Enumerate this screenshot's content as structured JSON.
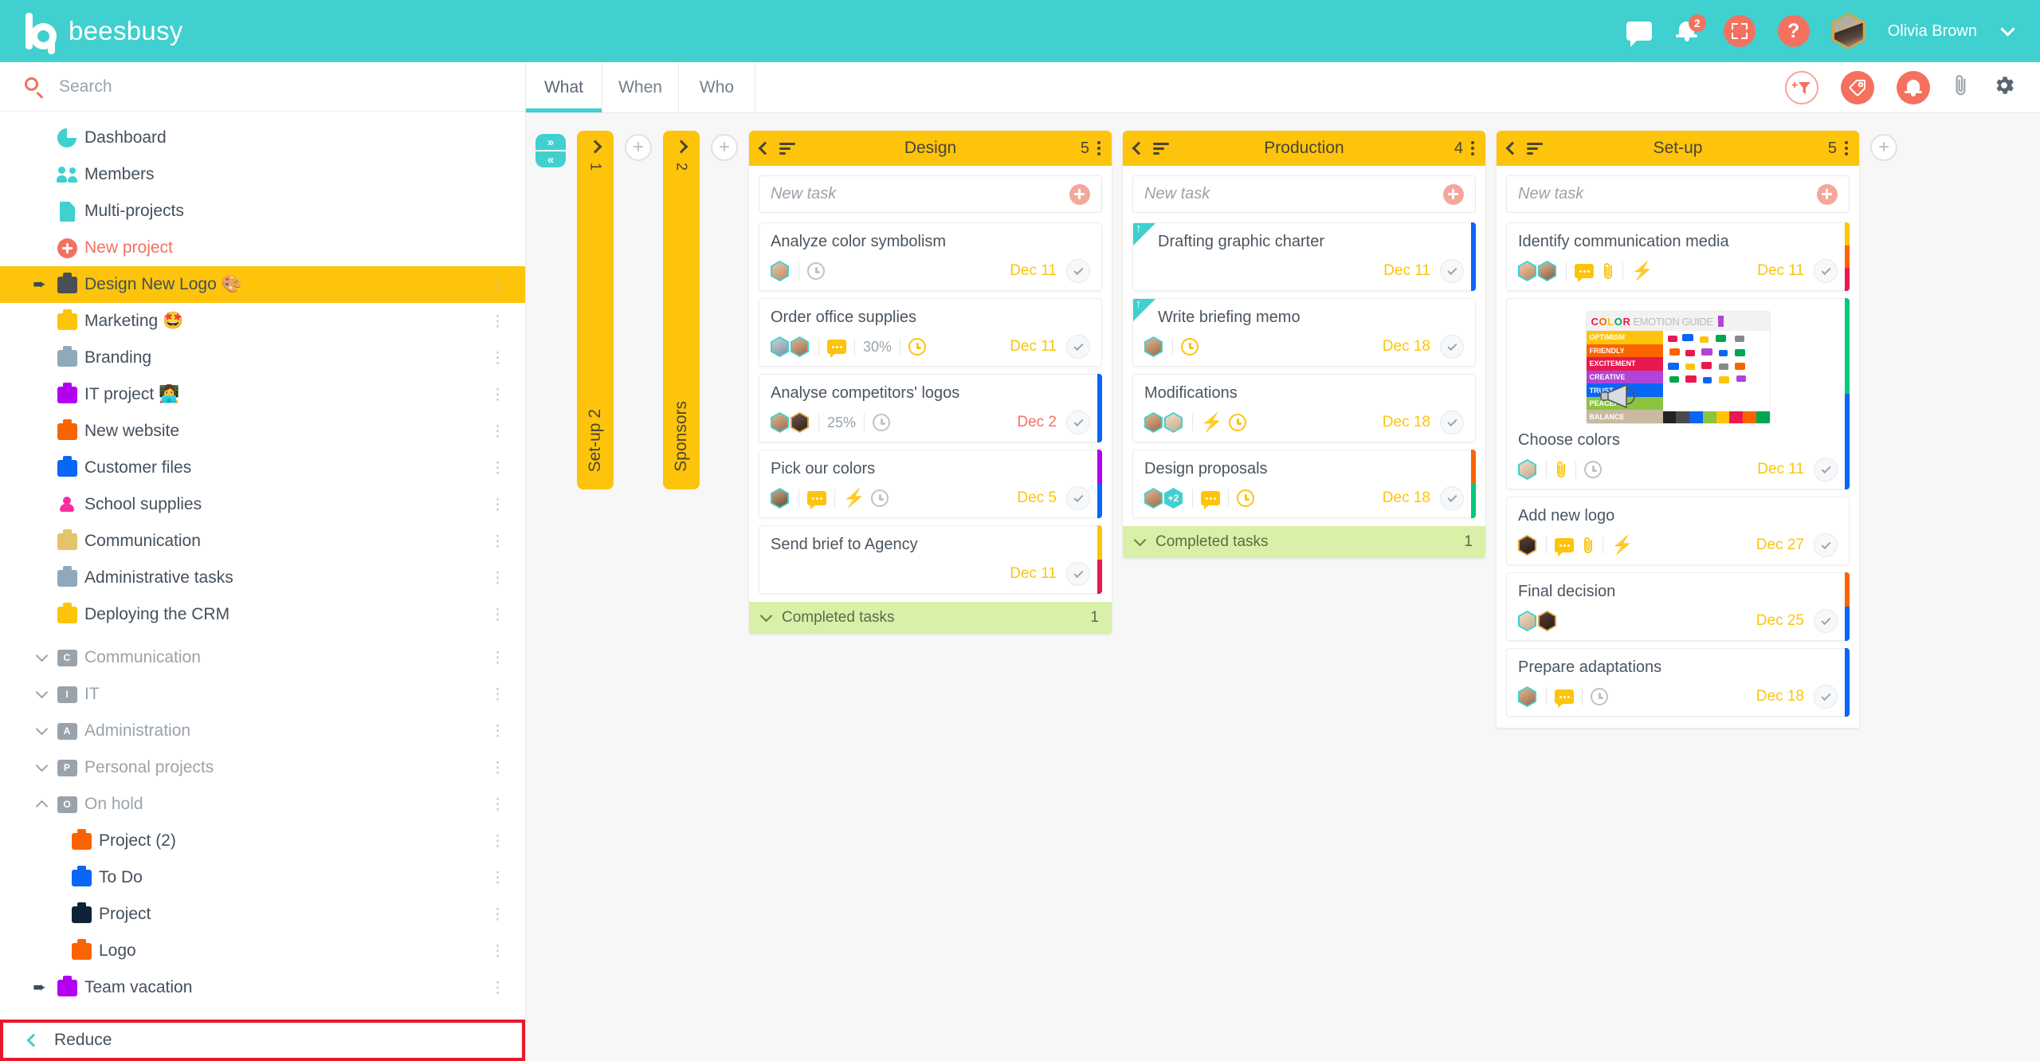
{
  "app": {
    "brand": "beesbusy",
    "brand_icon": "beesbusy-b-logo"
  },
  "topbar": {
    "chat_icon": "chat-bubble-icon",
    "notifications_icon": "bell-icon",
    "notifications_count": "2",
    "fullscreen_icon": "fullscreen-expand-icon",
    "help_icon": "question-mark-icon",
    "help_label": "?",
    "avatar_icon": "user-avatar",
    "user_name": "Olivia Brown",
    "chevron_icon": "chevron-down-icon"
  },
  "sidebar": {
    "search": {
      "icon": "search-icon",
      "value": "",
      "placeholder": "Search"
    },
    "nav": [
      {
        "label": "Dashboard",
        "icon": "pie-chart-icon",
        "type": "plain"
      },
      {
        "label": "Members",
        "icon": "people-icon",
        "type": "plain"
      },
      {
        "label": "Multi-projects",
        "icon": "document-icon",
        "type": "plain"
      },
      {
        "label": "New project",
        "icon": "plus-circle-icon",
        "type": "accent"
      }
    ],
    "projects": [
      {
        "label": "Design New Logo 🎨",
        "icon": "briefcase-icon",
        "color": "#4a4f56",
        "active": true,
        "pinned": true,
        "menu": true
      },
      {
        "label": "Marketing 🤩",
        "icon": "briefcase-icon",
        "color": "#fdc40b",
        "active": false,
        "pinned": false,
        "menu": true
      },
      {
        "label": "Branding",
        "icon": "briefcase-icon",
        "color": "#8fa9bb",
        "active": false,
        "pinned": false,
        "menu": true
      },
      {
        "label": "IT project 👩‍💻",
        "icon": "briefcase-icon",
        "color": "#b300f0",
        "active": false,
        "pinned": false,
        "menu": true
      },
      {
        "label": "New website",
        "icon": "briefcase-icon",
        "color": "#fa6400",
        "active": false,
        "pinned": false,
        "menu": true
      },
      {
        "label": "Customer files",
        "icon": "briefcase-icon",
        "color": "#0a66f5",
        "active": false,
        "pinned": false,
        "menu": true
      },
      {
        "label": "School supplies",
        "icon": "person-icon",
        "color": "#f62fa0",
        "active": false,
        "pinned": false,
        "menu": true
      },
      {
        "label": "Communication",
        "icon": "briefcase-icon",
        "color": "#e3c46b",
        "active": false,
        "pinned": false,
        "menu": true
      },
      {
        "label": "Administrative tasks",
        "icon": "briefcase-icon",
        "color": "#8fa9bb",
        "active": false,
        "pinned": false,
        "menu": true
      },
      {
        "label": "Deploying the CRM",
        "icon": "briefcase-icon",
        "color": "#fdc40b",
        "active": false,
        "pinned": false,
        "menu": true
      }
    ],
    "folders": [
      {
        "label": "Communication",
        "badge": "C",
        "expanded": false
      },
      {
        "label": "IT",
        "badge": "I",
        "expanded": false
      },
      {
        "label": "Administration",
        "badge": "A",
        "expanded": false
      },
      {
        "label": "Personal projects",
        "badge": "P",
        "expanded": false
      },
      {
        "label": "On hold",
        "badge": "O",
        "expanded": true
      }
    ],
    "onhold_children": [
      {
        "label": "Project (2)",
        "color": "#fa6400",
        "pinned": false
      },
      {
        "label": "To Do",
        "color": "#0a66f5",
        "pinned": false
      },
      {
        "label": "Project",
        "color": "#0d2438",
        "pinned": false
      },
      {
        "label": "Logo",
        "color": "#fa6400",
        "pinned": false
      },
      {
        "label": "Team vacation",
        "color": "#b300f0",
        "pinned": true
      }
    ],
    "reduce": {
      "label": "Reduce",
      "icon": "chevron-left-icon",
      "highlighted": true
    }
  },
  "toolbar": {
    "tabs": [
      {
        "label": "What",
        "active": true
      },
      {
        "label": "When",
        "active": false
      },
      {
        "label": "Who",
        "active": false
      }
    ],
    "actions": [
      {
        "name": "add-filter-button",
        "icon": "filter-plus-icon",
        "style": "outline"
      },
      {
        "name": "tags-button",
        "icon": "tag-icon",
        "style": "solid"
      },
      {
        "name": "alerts-button",
        "icon": "bell-icon",
        "style": "solid"
      },
      {
        "name": "attachments-button",
        "icon": "paperclip-icon",
        "style": "plain"
      },
      {
        "name": "settings-button",
        "icon": "gear-icon",
        "style": "plain"
      }
    ]
  },
  "board": {
    "collapse_toggle": {
      "expand_icon": "chevrons-right-icon",
      "collapse_icon": "chevrons-left-icon"
    },
    "add_column_label": "+",
    "collapsed_columns": [
      {
        "title": "Set-up 2",
        "count": "1"
      },
      {
        "title": "Sponsors",
        "count": "2"
      }
    ],
    "columns": [
      {
        "title": "Design",
        "count": "5",
        "new_task_placeholder": "New task",
        "completed": {
          "label": "Completed tasks",
          "count": "1"
        },
        "cards": [
          {
            "title": "Analyze color symbolism",
            "avatars": [
              "#d8bfa8"
            ],
            "comment": false,
            "percent": "",
            "clock": "grey",
            "bolt": false,
            "clip": false,
            "due": "Dec 11",
            "due_state": "soon",
            "flag": false,
            "bars": []
          },
          {
            "title": "Order office supplies",
            "avatars": [
              "#9fb8c4",
              "#b98b6a"
            ],
            "comment": true,
            "percent": "30%",
            "clock": "warn",
            "bolt": false,
            "clip": false,
            "due": "Dec 11",
            "due_state": "soon",
            "flag": false,
            "bars": []
          },
          {
            "title": "Analyse competitors' logos",
            "avatars": [
              "#b98b6a",
              "#5c4536"
            ],
            "comment": false,
            "percent": "25%",
            "clock": "grey",
            "bolt": false,
            "clip": false,
            "due": "Dec 2",
            "due_state": "late",
            "flag": false,
            "bars": [
              "#0a66f5"
            ]
          },
          {
            "title": "Pick our colors",
            "avatars": [
              "#8f6a4e"
            ],
            "comment": true,
            "percent": "",
            "clock": "grey",
            "bolt": true,
            "clip": false,
            "due": "Dec 5",
            "due_state": "soon",
            "flag": false,
            "bars": [
              "#b300f0",
              "#0a66f5"
            ]
          },
          {
            "title": "Send brief to Agency",
            "avatars": [],
            "comment": false,
            "percent": "",
            "clock": "none",
            "bolt": false,
            "clip": false,
            "due": "Dec 11",
            "due_state": "soon",
            "flag": false,
            "bars": [
              "#fdc40b",
              "#e8194f"
            ]
          }
        ]
      },
      {
        "title": "Production",
        "count": "4",
        "new_task_placeholder": "New task",
        "completed": {
          "label": "Completed tasks",
          "count": "1"
        },
        "cards": [
          {
            "title": "Drafting graphic charter",
            "avatars": [],
            "comment": false,
            "percent": "",
            "clock": "none",
            "bolt": false,
            "clip": false,
            "due": "Dec 11",
            "due_state": "soon",
            "flag": true,
            "bars": [
              "#0a66f5"
            ]
          },
          {
            "title": "Write briefing memo",
            "avatars": [
              "#b98b6a"
            ],
            "comment": false,
            "percent": "",
            "clock": "warn",
            "bolt": false,
            "clip": false,
            "due": "Dec 18",
            "due_state": "soon",
            "flag": true,
            "bars": []
          },
          {
            "title": "Modifications",
            "avatars": [
              "#b98b6a",
              "#d8c3a8"
            ],
            "comment": false,
            "percent": "",
            "clock": "warn",
            "bolt": true,
            "clip": false,
            "due": "Dec 18",
            "due_state": "soon",
            "flag": false,
            "bars": []
          },
          {
            "title": "Design proposals",
            "avatars": [
              "#b98b6a",
              "+2"
            ],
            "comment": true,
            "percent": "",
            "clock": "warn",
            "bolt": false,
            "clip": false,
            "due": "Dec 18",
            "due_state": "soon",
            "flag": false,
            "bars": [
              "#fa6400",
              "#00c97b"
            ]
          }
        ]
      },
      {
        "title": "Set-up",
        "count": "5",
        "new_task_placeholder": "New task",
        "completed": null,
        "cards": [
          {
            "title": "Identify communication media",
            "avatars": [
              "#b98b6a",
              "#8f6a4e"
            ],
            "comment": true,
            "percent": "",
            "clock": "none",
            "bolt": true,
            "clip": true,
            "due": "Dec 11",
            "due_state": "soon",
            "flag": false,
            "bars": [
              "#fdc40b",
              "#fa6400",
              "#e8194f"
            ]
          },
          {
            "title": "Choose colors",
            "image": "color-emotion-guide",
            "image_title_words": [
              "COLOR",
              "EMOTION GUIDE"
            ],
            "image_bands": [
              "OPTIMISM",
              "FRIENDLY",
              "EXCITEMENT",
              "CREATIVE",
              "TRUST",
              "PEACEFUL",
              "BALANCE"
            ],
            "avatars": [
              "#d8c3a8"
            ],
            "comment": false,
            "percent": "",
            "clock": "grey",
            "bolt": false,
            "clip": true,
            "due": "Dec 11",
            "due_state": "soon",
            "flag": false,
            "bars": [
              "#00c97b",
              "#0a66f5"
            ]
          },
          {
            "title": "Add new logo",
            "avatars": [
              "#4a3b33"
            ],
            "comment": true,
            "percent": "",
            "clock": "none",
            "bolt": true,
            "clip": true,
            "due": "Dec 27",
            "due_state": "soon",
            "flag": false,
            "bars": []
          },
          {
            "title": "Final decision",
            "avatars": [
              "#d8c3a8",
              "#4a3b33"
            ],
            "comment": false,
            "percent": "",
            "clock": "none",
            "bolt": false,
            "clip": false,
            "due": "Dec 25",
            "due_state": "soon",
            "flag": false,
            "bars": [
              "#fa6400",
              "#0a66f5"
            ]
          },
          {
            "title": "Prepare adaptations",
            "avatars": [
              "#b98b6a"
            ],
            "comment": true,
            "percent": "",
            "clock": "grey",
            "bolt": false,
            "clip": false,
            "due": "Dec 18",
            "due_state": "soon",
            "flag": false,
            "bars": [
              "#0a66f5"
            ]
          }
        ]
      }
    ]
  },
  "colors": {
    "brand_teal": "#3fd0cf",
    "accent_coral": "#f4715f",
    "column_yellow": "#fdc40b",
    "completed_green": "#d8f0a8",
    "highlight_red": "#e8192c"
  }
}
